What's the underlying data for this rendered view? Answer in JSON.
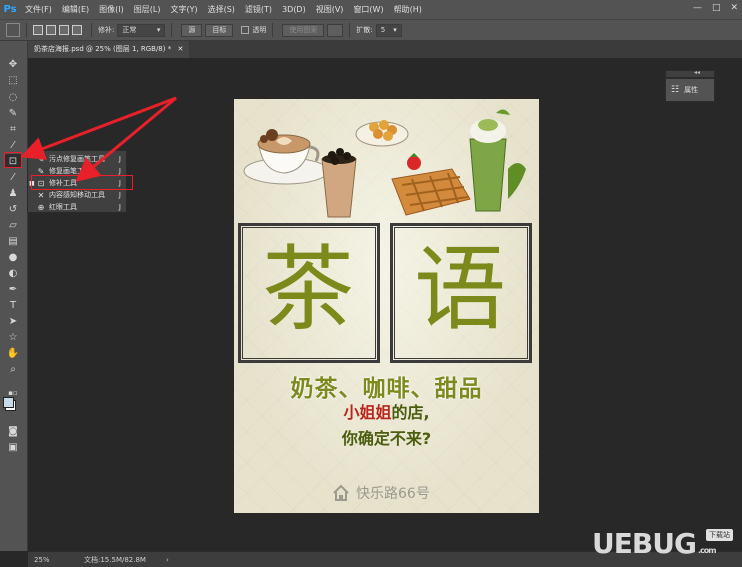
{
  "app": {
    "logo": "Ps",
    "menu": [
      "文件(F)",
      "编辑(E)",
      "图像(I)",
      "图层(L)",
      "文字(Y)",
      "选择(S)",
      "滤镜(T)",
      "3D(D)",
      "视图(V)",
      "窗口(W)",
      "帮助(H)"
    ],
    "window_controls": [
      "—",
      "□",
      "✕"
    ]
  },
  "options": {
    "repair_label": "修补:",
    "repair_mode": "正常",
    "source_btn": "源",
    "target_btn": "目标",
    "transparent_label": "透明",
    "use_pattern_btn": "使用图案",
    "diffusion_label": "扩散:",
    "diffusion_value": "5"
  },
  "document": {
    "tab_title": "奶茶店海报.psd @ 25% (图层 1, RGB/8) *",
    "close": "✕"
  },
  "flyout": {
    "items": [
      {
        "label": "污点修复画笔工具",
        "key": "J"
      },
      {
        "label": "修复画笔工具",
        "key": "J"
      },
      {
        "label": "修补工具",
        "key": "J"
      },
      {
        "label": "内容感知移动工具",
        "key": "J"
      },
      {
        "label": "红眼工具",
        "key": "J"
      }
    ]
  },
  "poster": {
    "char1": "茶",
    "char2": "语",
    "slogan1": "奶茶、咖啡、甜品",
    "slogan2_red": "小姐姐",
    "slogan2_rest": "的店,",
    "slogan3": "你确定不来?",
    "address": "快乐路66号"
  },
  "panel": {
    "properties": "属性",
    "collapse": "◂◂"
  },
  "status": {
    "zoom": "25%",
    "doc_info": "文档:15.5M/82.8M",
    "arrow": "›"
  },
  "watermark": {
    "text": "UEBUG",
    "suffix": ".com",
    "badge": "下载站"
  },
  "colors": {
    "accent_red": "#e8202a",
    "olive": "#7b8a1a",
    "ps_blue": "#31a8ff"
  }
}
